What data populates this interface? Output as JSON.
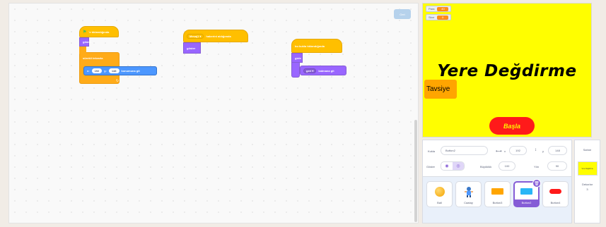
{
  "code_area": {
    "clean_button_label": "Geri",
    "script1": {
      "hat_label": "'e tıklandığında",
      "show_label": "göster",
      "forever_label": "sürekli tekrarla",
      "goto_x_label": "x:",
      "goto_x": "192",
      "goto_y_label": "y:",
      "goto_y": "148",
      "goto_suffix": "konumuna git"
    },
    "script2": {
      "hat_dropdown": "Mesaj1",
      "hat_label": "haberini aldığımda",
      "show_label": "göster"
    },
    "script3": {
      "hat_label": "bu kukla tıklandığında",
      "hide_label": "gizle",
      "layer_dropdown": "geri",
      "layer_suffix": "katmana git"
    }
  },
  "stage": {
    "monitors": [
      {
        "label": "Para",
        "value": "40"
      },
      {
        "label": "Skor",
        "value": "0"
      }
    ],
    "title_text": "Yere Değdirme",
    "tavsiye_label": "Tavsiye",
    "basla_label": "Başla"
  },
  "sprite_info": {
    "sprite_label": "Kukla",
    "sprite_name": "Button2",
    "x_label": "x",
    "x_value": "192",
    "y_label": "y",
    "y_value": "148",
    "show_label": "Göster",
    "size_label": "Büyüklük",
    "size_value": "100",
    "direction_label": "Yön",
    "direction_value": "90"
  },
  "sprites": [
    {
      "name": "Ball"
    },
    {
      "name": "Caatay"
    },
    {
      "name": "Button3"
    },
    {
      "name": "Button2",
      "selected": true
    },
    {
      "name": "Button4"
    }
  ],
  "stage_tab": {
    "heading": "Sahne",
    "thumb_text": "Yere Değdirme",
    "backdrops_label": "Dekorlar",
    "backdrops_count": "3"
  },
  "colors": {
    "events": "#ffbf00",
    "looks": "#9966ff",
    "control": "#ffab19",
    "motion": "#4c97ff",
    "stage_bg": "#fffe00",
    "selection": "#855cd6"
  }
}
